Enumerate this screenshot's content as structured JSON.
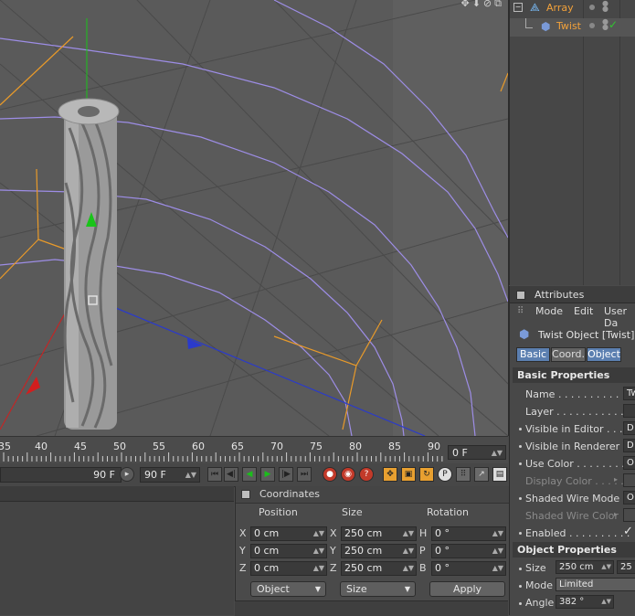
{
  "timeline": {
    "ticks": [
      "35",
      "40",
      "45",
      "50",
      "55",
      "60",
      "65",
      "70",
      "75",
      "80",
      "85",
      "90"
    ],
    "current_frame": "0 F"
  },
  "transport": {
    "end_frame_left": "90 F",
    "end_frame_right": "90 F"
  },
  "left_panel": {},
  "coordinates": {
    "title": "Coordinates",
    "headers": {
      "position": "Position",
      "size": "Size",
      "rotation": "Rotation"
    },
    "rows": [
      {
        "axis": "X",
        "pos": "0 cm",
        "size_axis": "X",
        "size": "250 cm",
        "rot_axis": "H",
        "rot": "0 °"
      },
      {
        "axis": "Y",
        "pos": "0 cm",
        "size_axis": "Y",
        "size": "250 cm",
        "rot_axis": "P",
        "rot": "0 °"
      },
      {
        "axis": "Z",
        "pos": "0 cm",
        "size_axis": "Z",
        "size": "250 cm",
        "rot_axis": "B",
        "rot": "0 °"
      }
    ],
    "mode_dropdown": "Object",
    "size_dropdown": "Size",
    "apply_label": "Apply"
  },
  "object_manager": {
    "objects": [
      {
        "name": "Array",
        "icon": "array-icon"
      },
      {
        "name": "Twist",
        "icon": "twist-deformer-icon"
      }
    ]
  },
  "attributes": {
    "title": "Attributes",
    "menu": [
      "Mode",
      "Edit",
      "User Da"
    ],
    "object_title": "Twist Object [Twist]",
    "tabs": [
      "Basic",
      "Coord.",
      "Object"
    ],
    "basic_section": "Basic Properties",
    "basic_props": [
      {
        "label": "Name . . . . . . . . . . . .",
        "value": "Tw",
        "dot": false,
        "dim": false
      },
      {
        "label": "Layer . . . . . . . . . . . .",
        "value": "",
        "dot": false,
        "dim": false
      },
      {
        "label": "Visible in Editor . . . .",
        "value": "D",
        "dot": true,
        "dim": false
      },
      {
        "label": "Visible in Renderer .",
        "value": "D",
        "dot": true,
        "dim": false
      },
      {
        "label": "Use Color . . . . . . . .",
        "value": "O",
        "dot": true,
        "dim": false
      },
      {
        "label": "Display Color . . . . .",
        "value": "",
        "dot": false,
        "dim": true
      },
      {
        "label": "Shaded Wire Mode",
        "value": "O",
        "dot": true,
        "dim": false
      },
      {
        "label": "Shaded Wire Color",
        "value": "",
        "dot": false,
        "dim": true
      },
      {
        "label": "Enabled . . . . . . . . . .",
        "value": "✓",
        "dot": true,
        "dim": false
      }
    ],
    "object_section": "Object Properties",
    "object_props": [
      {
        "label": "Size",
        "value": "250 cm",
        "value2": "25"
      },
      {
        "label": "Mode",
        "value": "Limited"
      },
      {
        "label": "Angle",
        "value": "382 °"
      }
    ]
  },
  "colors": {
    "accent_orange": "#f2a13a",
    "tab_active": "#5b7fb0",
    "axis_y": "#19c419",
    "axis_x": "#d21e1e",
    "axis_z": "#2a3acb"
  }
}
